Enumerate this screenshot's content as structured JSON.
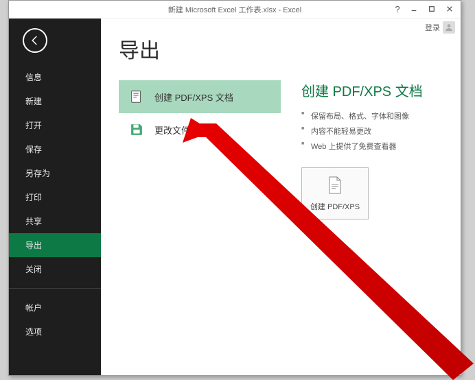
{
  "titlebar": {
    "title": "新建 Microsoft Excel 工作表.xlsx - Excel",
    "login": "登录"
  },
  "sidebar": {
    "items": [
      {
        "label": "信息"
      },
      {
        "label": "新建"
      },
      {
        "label": "打开"
      },
      {
        "label": "保存"
      },
      {
        "label": "另存为"
      },
      {
        "label": "打印"
      },
      {
        "label": "共享"
      },
      {
        "label": "导出"
      },
      {
        "label": "关闭"
      }
    ],
    "footer": [
      {
        "label": "帐户"
      },
      {
        "label": "选项"
      }
    ]
  },
  "main": {
    "title": "导出",
    "options": [
      {
        "label": "创建 PDF/XPS 文档"
      },
      {
        "label": "更改文件类型"
      }
    ],
    "section": {
      "heading": "创建 PDF/XPS 文档",
      "bullets": [
        "保留布局、格式、字体和图像",
        "内容不能轻易更改",
        "Web 上提供了免费查看器"
      ],
      "action": "创建 PDF/XPS"
    }
  }
}
